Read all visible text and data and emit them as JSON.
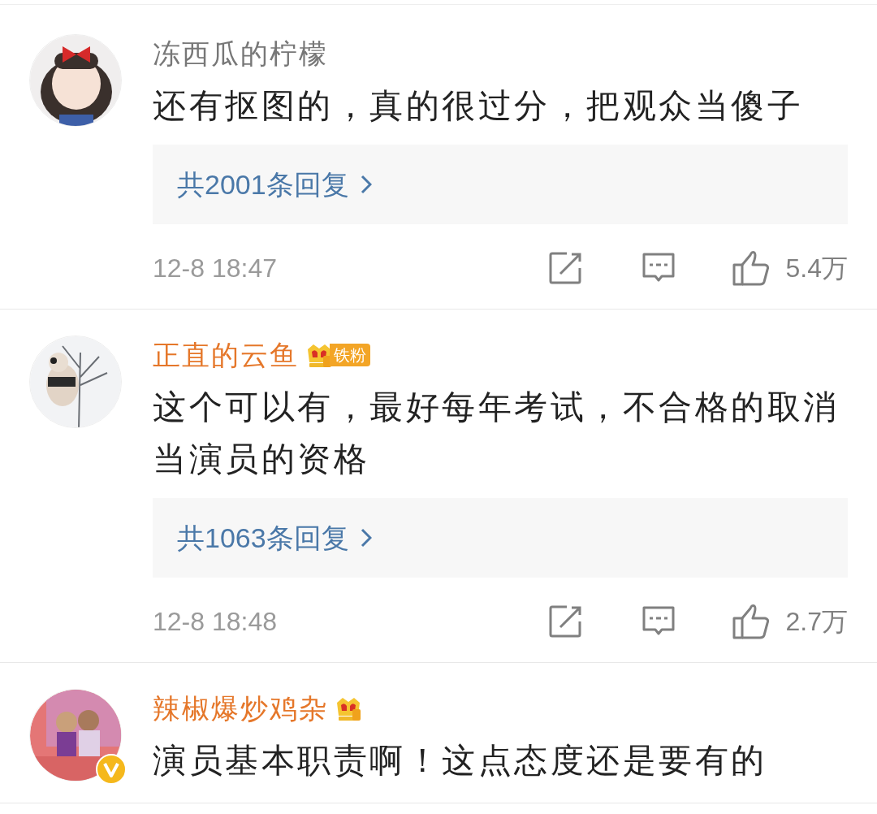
{
  "comments": [
    {
      "name": "冻西瓜的柠檬",
      "vip": false,
      "crown": false,
      "verified": false,
      "text": "还有抠图的，真的很过分，把观众当傻子",
      "replies": "共2001条回复",
      "time": "12-8 18:47",
      "likes": "5.4万"
    },
    {
      "name": "正直的云鱼",
      "vip": true,
      "crown": true,
      "fan_badge": "铁粉",
      "verified": false,
      "text": "这个可以有，最好每年考试，不合格的取消当演员的资格",
      "replies": "共1063条回复",
      "time": "12-8 18:48",
      "likes": "2.7万"
    },
    {
      "name": "辣椒爆炒鸡杂",
      "vip": true,
      "crown": true,
      "verified": true,
      "text": "演员基本职责啊！这点态度还是要有的"
    }
  ]
}
